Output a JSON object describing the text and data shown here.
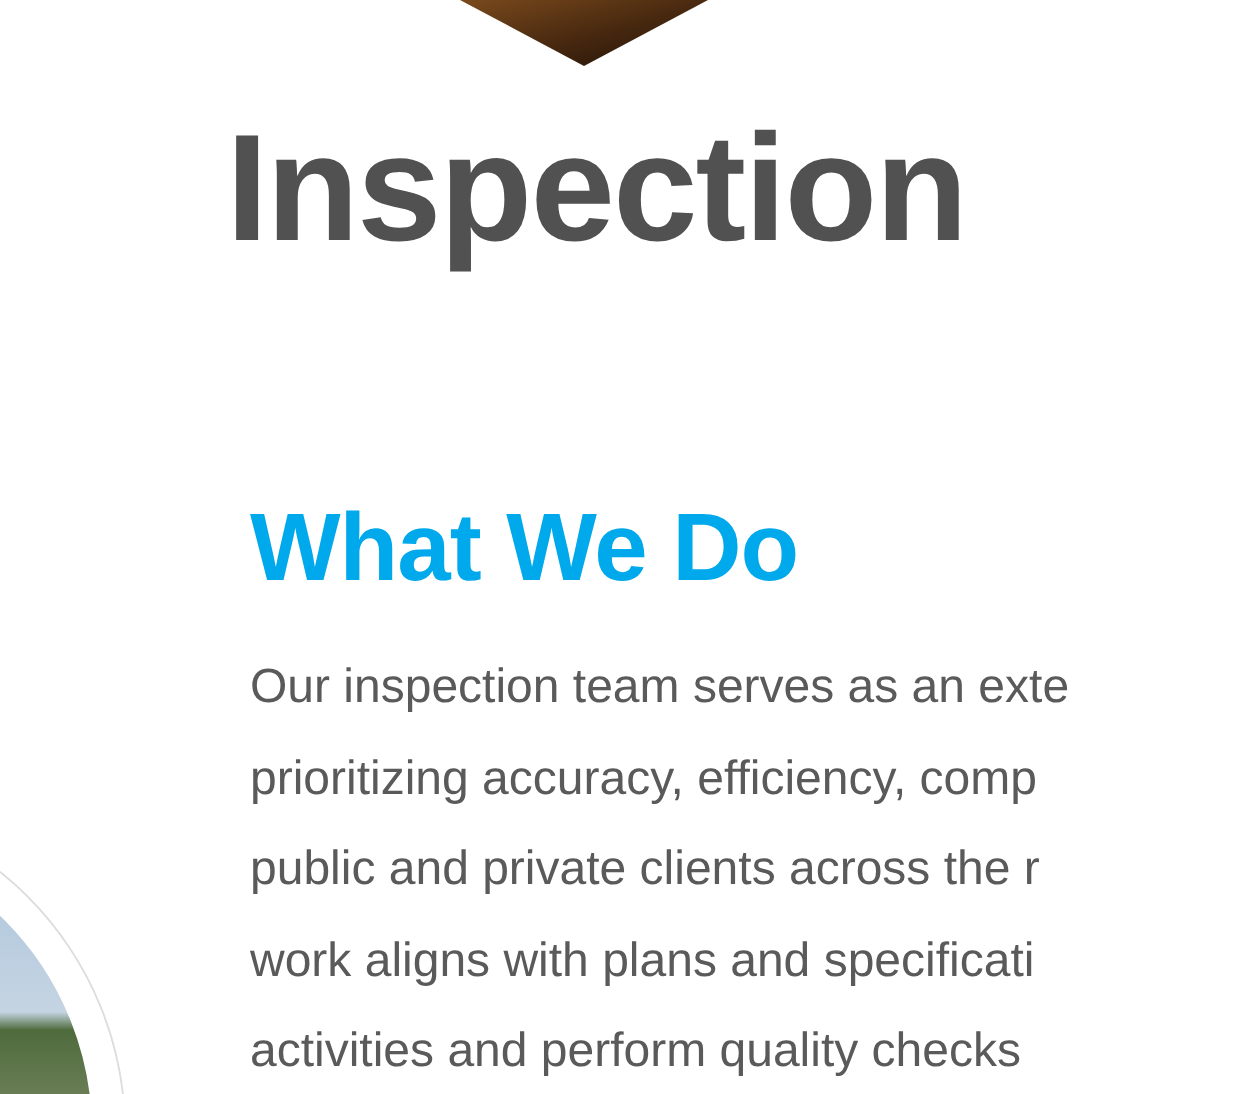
{
  "page_title": "Inspection",
  "section": {
    "heading": "What We Do",
    "lines": [
      "Our inspection team serves as an exte",
      "prioritizing accuracy, efficiency, comp",
      "public and private clients across the r",
      "work aligns with plans and specificati",
      "activities and perform quality checks"
    ]
  }
}
